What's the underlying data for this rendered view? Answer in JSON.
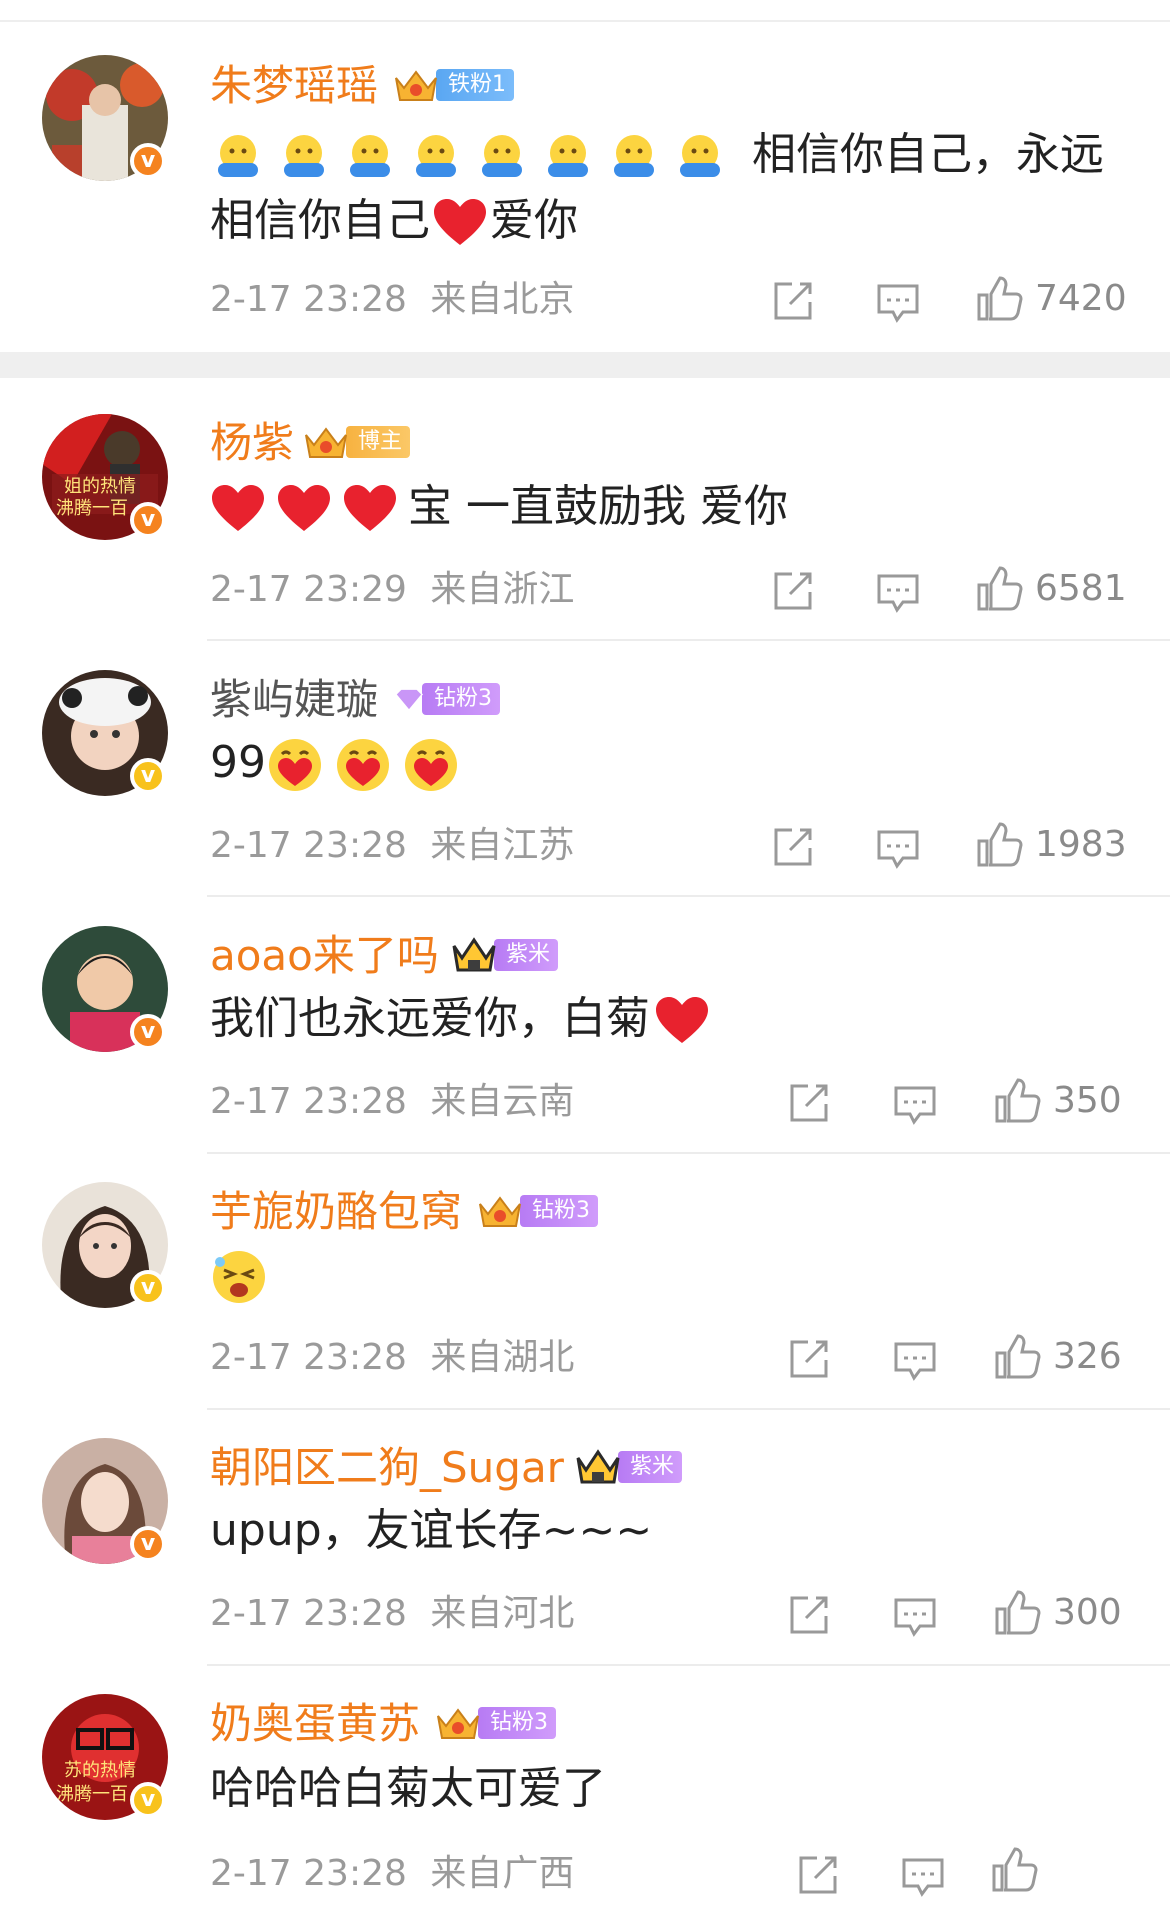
{
  "comments": [
    {
      "username": "朱梦瑶瑶",
      "badge": "铁粉1",
      "text_line1": "相信你自己，永远",
      "text_line2_a": "相信你自己",
      "text_line2_b": "爱你",
      "time": "2-17 23:28",
      "location": "来自北京",
      "likes": "7420",
      "emoji": "hug-emoji x8, red-heart"
    },
    {
      "username": "杨紫",
      "badge": "博主",
      "text": "宝 一直鼓励我 爱你",
      "time": "2-17 23:29",
      "location": "来自浙江",
      "likes": "6581",
      "emoji": "red-heart x3"
    },
    {
      "username": "紫屿婕璇",
      "badge": "钻粉3",
      "text": "99",
      "time": "2-17 23:28",
      "location": "来自江苏",
      "likes": "1983",
      "emoji": "heart-hug-emoji x3"
    },
    {
      "username": "aoao来了吗",
      "badge": "紫米",
      "text": "我们也永远爱你，白菊",
      "time": "2-17 23:28",
      "location": "来自云南",
      "likes": "350",
      "emoji": "red-heart"
    },
    {
      "username": "芋旎奶酪包窝",
      "badge": "钻粉3",
      "text": "",
      "time": "2-17 23:28",
      "location": "来自湖北",
      "likes": "326",
      "emoji": "laughing-emoji"
    },
    {
      "username": "朝阳区二狗_Sugar",
      "badge": "紫米",
      "text": "upup，友谊长存~~~",
      "time": "2-17 23:28",
      "location": "来自河北",
      "likes": "300"
    },
    {
      "username": "奶奥蛋黄苏",
      "badge": "钻粉3",
      "text": "哈哈哈白菊太可爱了",
      "time": "2-17 23:28",
      "location": "来自广西"
    }
  ],
  "colors": {
    "name_orange": "#f07c1b",
    "name_gray": "#555555",
    "text": "#222222",
    "meta": "#9a9a9a",
    "heart": "#e8222e"
  }
}
